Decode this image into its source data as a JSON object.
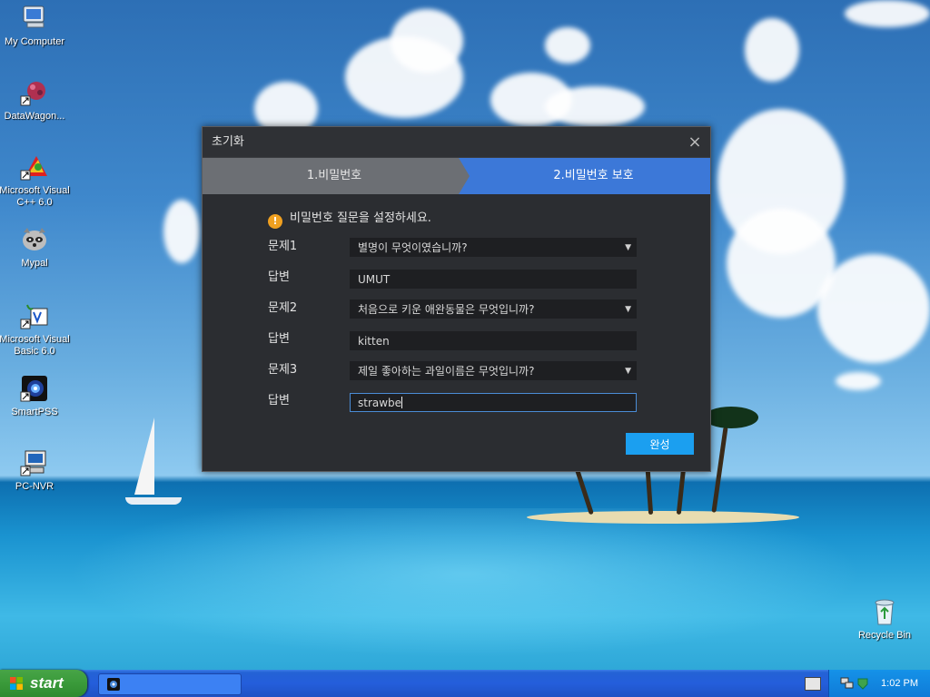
{
  "desktop": {
    "icons": [
      {
        "label": "My Computer"
      },
      {
        "label": "DataWagon..."
      },
      {
        "label": "Microsoft Visual C++ 6.0"
      },
      {
        "label": "Mypal"
      },
      {
        "label": "Microsoft Visual Basic 6.0"
      },
      {
        "label": "SmartPSS"
      },
      {
        "label": "PC-NVR"
      },
      {
        "label": "Recycle Bin"
      }
    ]
  },
  "dialog": {
    "title": "초기화",
    "close_glyph": "×",
    "steps": [
      {
        "label": "1.비밀번호",
        "active": false
      },
      {
        "label": "2.비밀번호 보호",
        "active": true
      }
    ],
    "notice": "비밀번호 질문을 설정하세요.",
    "notice_icon": "!",
    "rows": [
      {
        "label": "문제1",
        "value": "별명이 무엇이였습니까?",
        "type": "select"
      },
      {
        "label": "답변",
        "value": "UMUT",
        "type": "input"
      },
      {
        "label": "문제2",
        "value": "처음으로 키운 애완동물은 무엇입니까?",
        "type": "select"
      },
      {
        "label": "답변",
        "value": "kitten",
        "type": "input"
      },
      {
        "label": "문제3",
        "value": "제일 좋아하는 과일이름은 무엇입니까?",
        "type": "select"
      },
      {
        "label": "답변",
        "value": "strawbe",
        "type": "input"
      }
    ],
    "done_label": "완성",
    "caret": "▼"
  },
  "taskbar": {
    "start_label": "start",
    "clock": "1:02 PM"
  },
  "colors": {
    "step_active": "#3c78d8",
    "step_inactive": "#6c6f74",
    "done_button": "#1b9ff0",
    "dialog_bg": "#2b2d31"
  }
}
